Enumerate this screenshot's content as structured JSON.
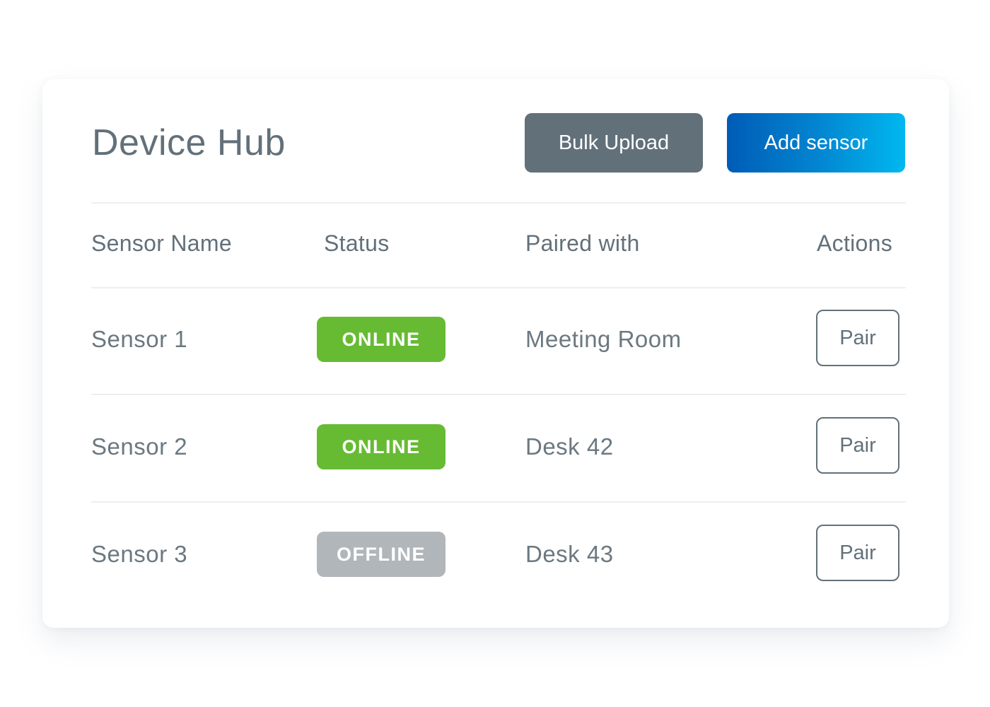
{
  "header": {
    "title": "Device Hub",
    "bulk_upload_label": "Bulk Upload",
    "add_sensor_label": "Add sensor"
  },
  "colors": {
    "primary_gradient_start": "#005cb6",
    "primary_gradient_end": "#00b8ef",
    "secondary_button": "#62707a",
    "online": "#66bb33",
    "offline": "#b1b6ba",
    "text": "#62707a"
  },
  "table": {
    "columns": [
      "Sensor Name",
      "Status",
      "Paired with",
      "Actions"
    ],
    "rows": [
      {
        "name": "Sensor 1",
        "status": "ONLINE",
        "paired_with": "Meeting Room",
        "action": "Pair"
      },
      {
        "name": "Sensor 2",
        "status": "ONLINE",
        "paired_with": "Desk 42",
        "action": "Pair"
      },
      {
        "name": "Sensor 3",
        "status": "OFFLINE",
        "paired_with": "Desk 43",
        "action": "Pair"
      }
    ]
  }
}
